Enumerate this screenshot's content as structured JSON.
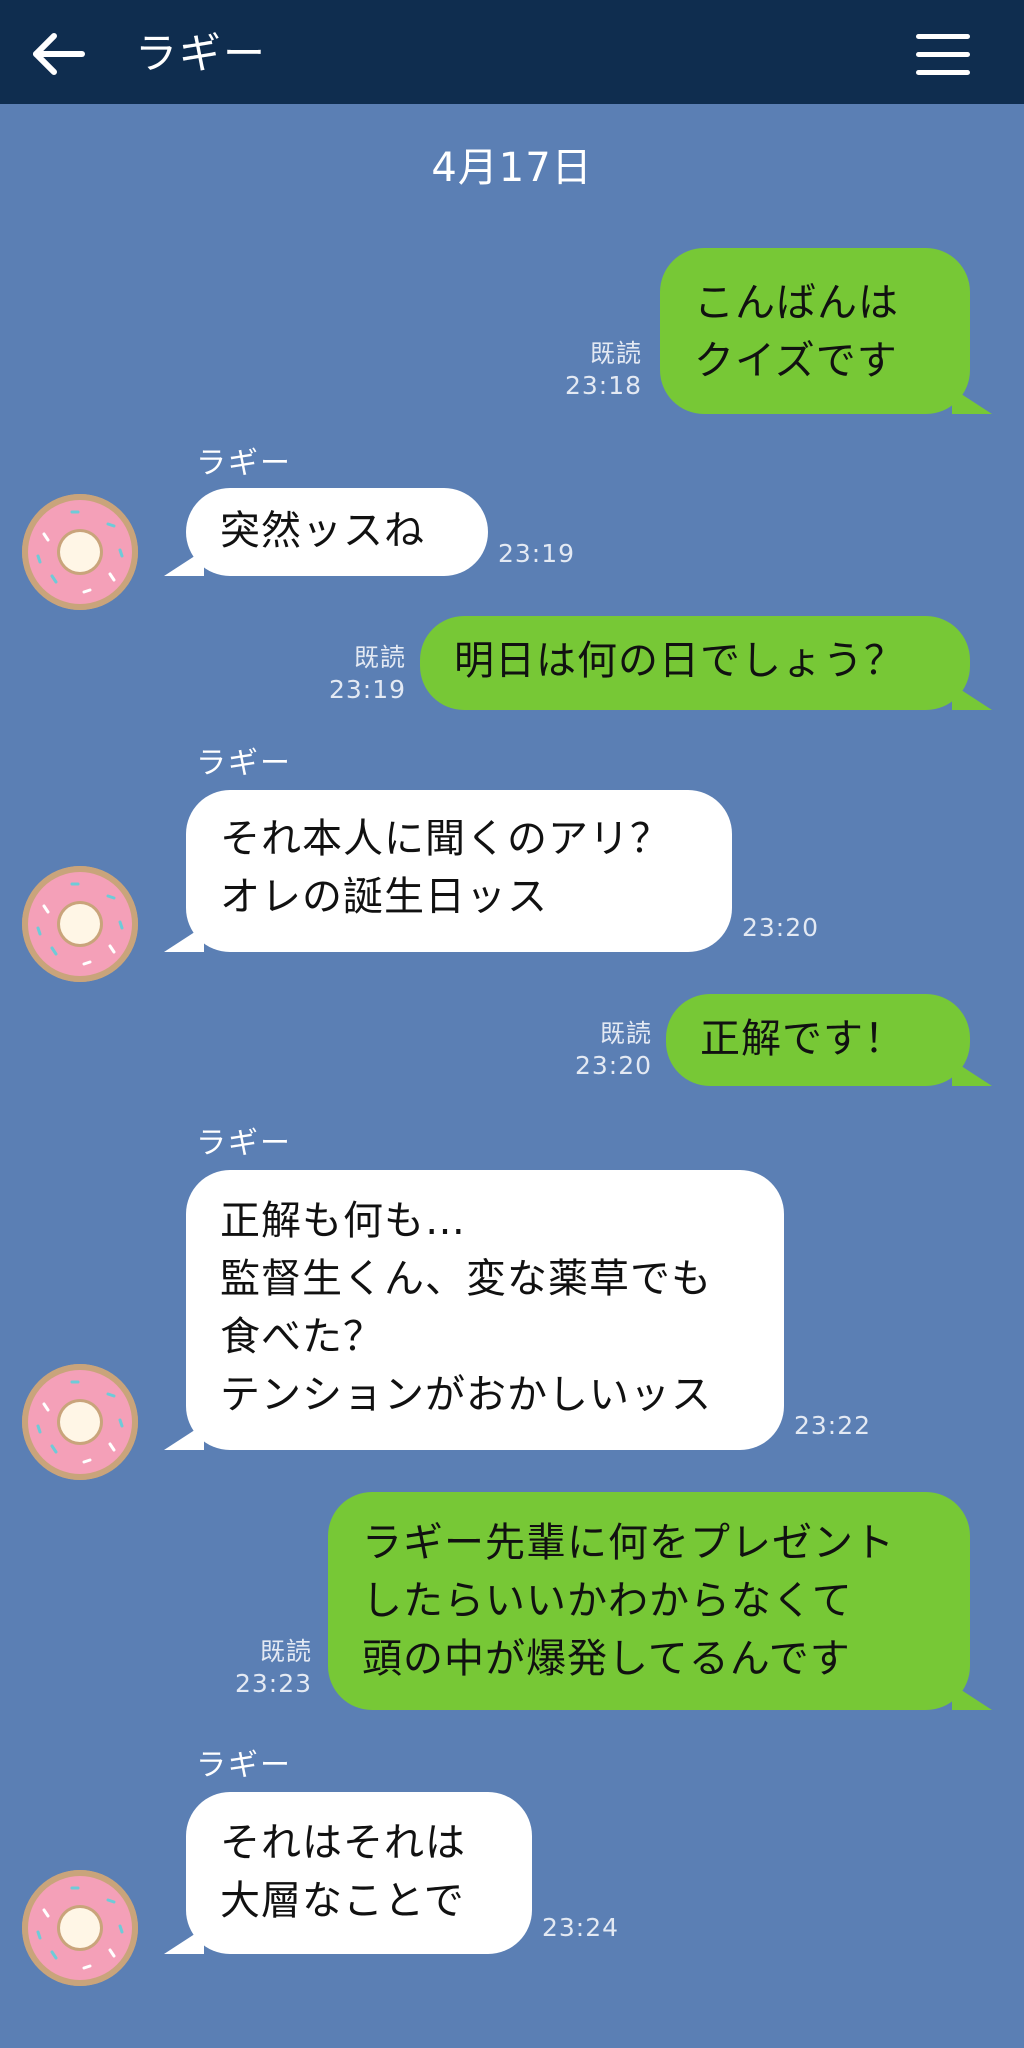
{
  "header": {
    "title": "ラギー"
  },
  "date": "4月17日",
  "contact": {
    "name": "ラギー"
  },
  "messages": [
    {
      "dir": "out",
      "lines": [
        "こんばんは",
        "クイズです"
      ],
      "read": "既読",
      "time": "23:18"
    },
    {
      "dir": "in",
      "sender": "ラギー",
      "lines": [
        "突然ッスね"
      ],
      "time": "23:19"
    },
    {
      "dir": "out",
      "lines": [
        "明日は何の日でしょう？"
      ],
      "read": "既読",
      "time": "23:19"
    },
    {
      "dir": "in",
      "sender": "ラギー",
      "lines": [
        "それ本人に聞くのアリ？",
        "オレの誕生日ッス"
      ],
      "time": "23:20"
    },
    {
      "dir": "out",
      "lines": [
        "正解です！"
      ],
      "read": "既読",
      "time": "23:20"
    },
    {
      "dir": "in",
      "sender": "ラギー",
      "lines": [
        "正解も何も…",
        "監督生くん、変な薬草でも",
        "食べた？",
        "テンションがおかしいッス"
      ],
      "time": "23:22"
    },
    {
      "dir": "out",
      "lines": [
        "ラギー先輩に何をプレゼント",
        "したらいいかわからなくて",
        "頭の中が爆発してるんです"
      ],
      "read": "既読",
      "time": "23:23"
    },
    {
      "dir": "in",
      "sender": "ラギー",
      "lines": [
        "それはそれは",
        "大層なことで"
      ],
      "time": "23:24"
    }
  ],
  "icons": {
    "back": "arrow-left-icon",
    "menu": "hamburger-menu-icon",
    "avatar": "donut-icon"
  },
  "colors": {
    "background": "#5b7fb4",
    "header": "#0f2d4f",
    "outgoing": "#77c836",
    "incoming": "#ffffff"
  }
}
